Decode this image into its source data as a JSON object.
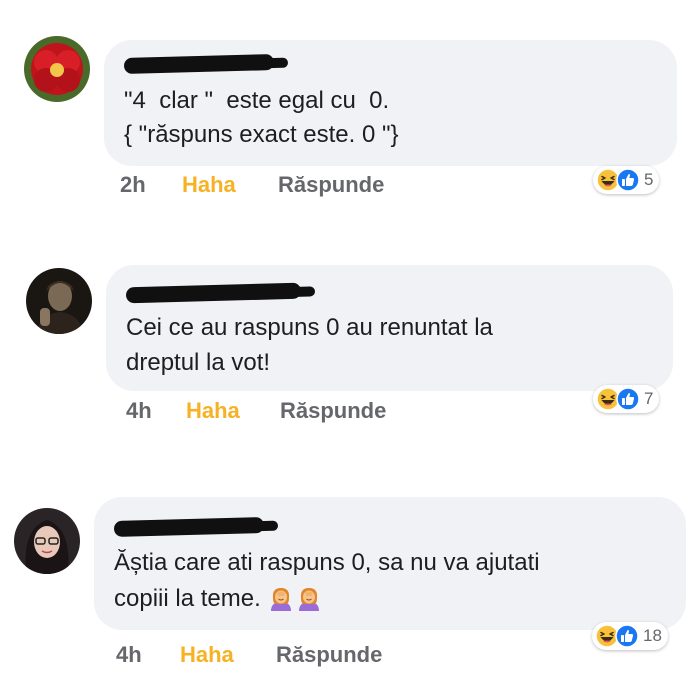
{
  "comments": [
    {
      "text_lines": [
        "\"4  clar \"  este egal cu  0.",
        "{ \"răspuns exact este. 0 \"}"
      ],
      "time": "2h",
      "haha": "Haha",
      "reply": "Răspunde",
      "reaction_count": "5",
      "reaction_icons": [
        "haha-icon",
        "like-icon"
      ]
    },
    {
      "text_lines": [
        "Cei ce au raspuns 0 au renuntat la",
        "dreptul la vot!"
      ],
      "time": "4h",
      "haha": "Haha",
      "reply": "Răspunde",
      "reaction_count": "7",
      "reaction_icons": [
        "haha-icon",
        "like-icon"
      ]
    },
    {
      "text_lines": [
        "Ăștia care ati raspuns 0, sa nu va ajutati",
        "copiii la teme."
      ],
      "time": "4h",
      "haha": "Haha",
      "reply": "Răspunde",
      "reaction_count": "18",
      "reaction_icons": [
        "haha-icon",
        "like-icon"
      ],
      "inline_emojis": [
        "woman-facepalming-icon",
        "woman-facepalming-icon"
      ]
    }
  ],
  "colors": {
    "bubble": "#f0f2f5",
    "haha_text": "#f7b125",
    "meta_text": "#65676b",
    "like_blue": "#1877f2"
  }
}
